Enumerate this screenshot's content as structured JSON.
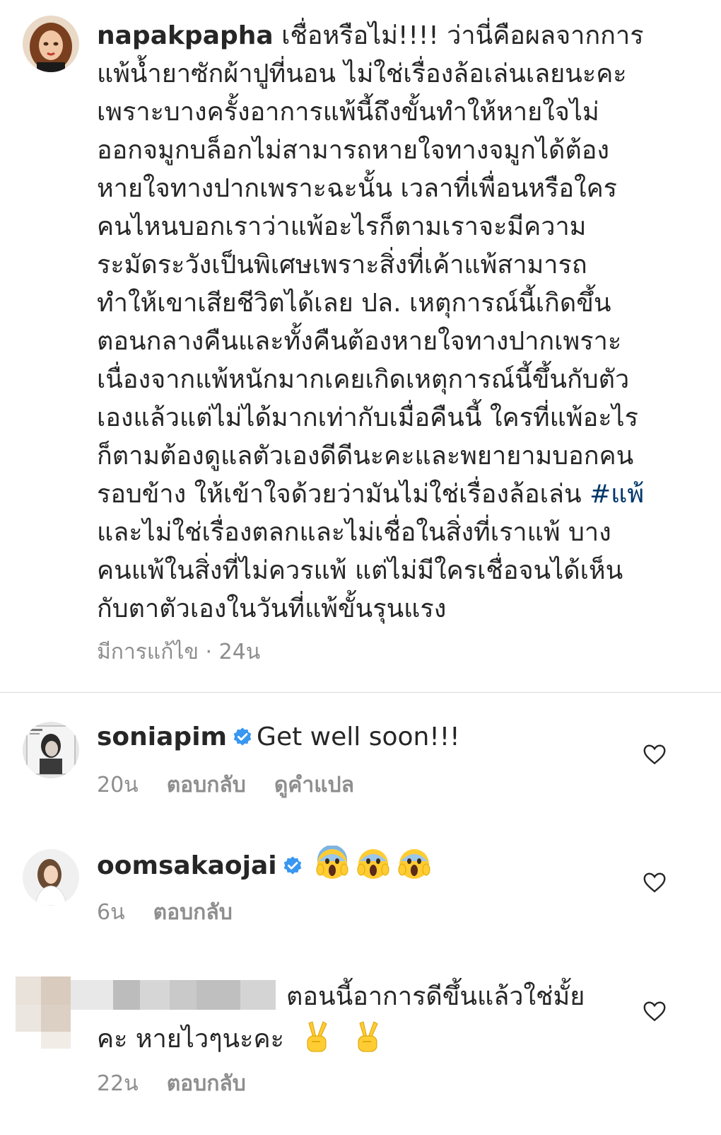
{
  "post": {
    "username": "napakpapha",
    "lines": [
      " เชื่อหรือไม่!!!! ว่านี่คือผลจากการ",
      "แพ้น้ำยาซักผ้าปูที่นอน ไม่ใช่เรื่องล้อเล่นเลยนะคะ",
      "เพราะบางครั้งอาการแพ้นี้ถึงขั้นทำให้หายใจไม่",
      "ออกจมูกบล็อกไม่สามารถหายใจทางจมูกได้ต้อง",
      "หายใจทางปากเพราะฉะนั้น เวลาที่เพื่อนหรือใคร",
      "คนไหนบอกเราว่าแพ้อะไรก็ตามเราจะมีความ",
      "ระมัดระวังเป็นพิเศษเพราะสิ่งที่เค้าแพ้สามารถ",
      "ทำให้เขาเสียชีวิตได้เลย ปล. เหตุการณ์นี้เกิดขึ้น",
      "ตอนกลางคืนและทั้งคืนต้องหายใจทางปากเพราะ",
      "เนื่องจากแพ้หนักมากเคยเกิดเหตุการณ์นี้ขึ้นกับตัว",
      "เองแล้วแต่ไม่ได้มากเท่ากับเมื่อคืนนี้ ใครที่แพ้อะไร",
      "ก็ตามต้องดูแลตัวเองดีดีนะคะและพยายามบอกคน",
      "รอบข้าง ให้เข้าใจด้วยว่ามันไม่ใช่เรื่องล้อเล่น ",
      "และไม่ใช่เรื่องตลกและไม่เชื่อในสิ่งที่เราแพ้ บาง",
      "คนแพ้ในสิ่งที่ไม่ควรแพ้ แต่ไม่มีใครเชื่อจนได้เห็น",
      "กับตาตัวเองในวันที่แพ้ขั้นรุนแรง"
    ],
    "hashtag": "#แพ้",
    "meta": "มีการแก้ไข · 24น"
  },
  "comments": [
    {
      "username": "soniapim",
      "text": "Get well soon!!!",
      "time": "20น",
      "reply": "ตอบกลับ",
      "translate": "ดูคำแปล"
    },
    {
      "username": "oomsakaojai",
      "emoji": "face-screaming-in-fear",
      "time": "6น",
      "reply": "ตอบกลับ"
    },
    {
      "username": "",
      "line1": "ตอนนี้อาการดีขึ้นแล้วใช่มั้ย",
      "line2": "คะ หายไวๆนะคะ",
      "emoji": "victory-hand",
      "time": "22น",
      "reply": "ตอบกลับ"
    }
  ],
  "colors": {
    "text": "#262626",
    "secondary": "#8e8e8e",
    "link": "#00376b",
    "verified": "#3897f0",
    "divider": "#dbdbdb"
  }
}
